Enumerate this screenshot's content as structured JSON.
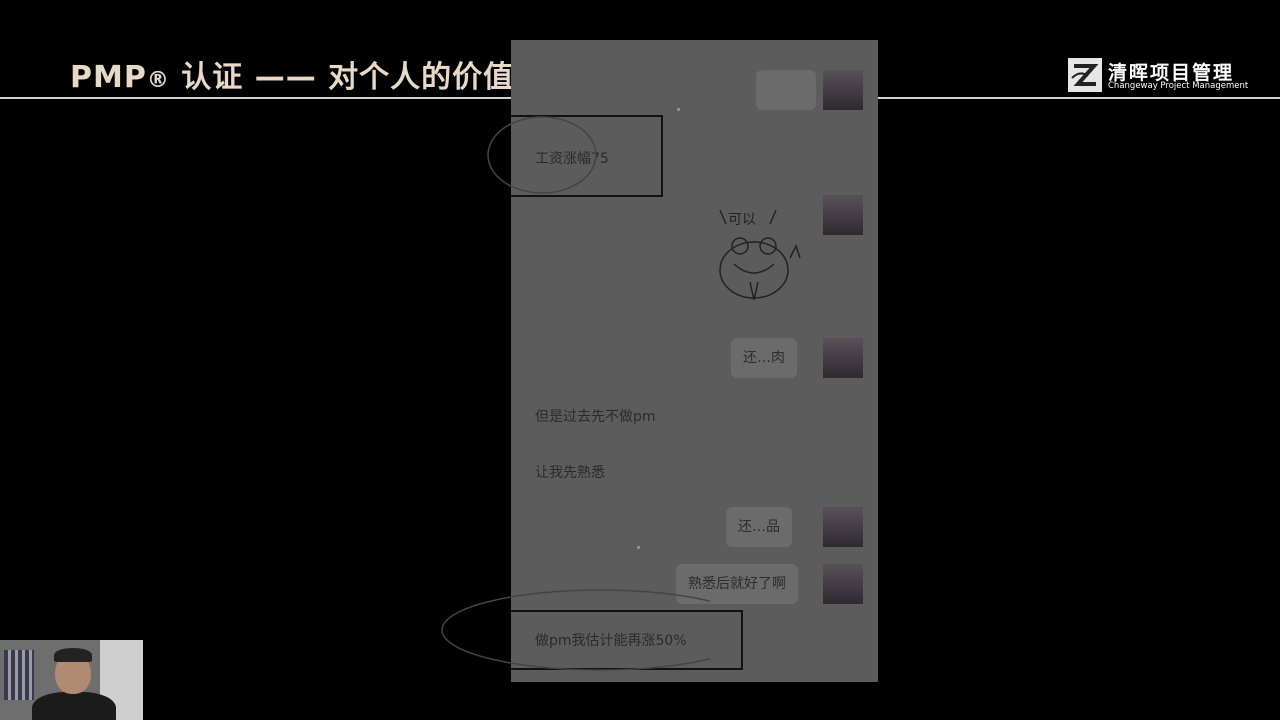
{
  "header": {
    "title_main": "PMP",
    "title_reg": "®",
    "title_rest": " 认证 —— 对个人的价值"
  },
  "logo": {
    "cn": "清晖项目管理",
    "en": "Changeway Project Management"
  },
  "chat": {
    "msg_salary": "工资涨幅75",
    "sticker_caption": "可以",
    "reply_1": "还…肉",
    "msg_but": "但是过去先不做pm",
    "msg_let": "让我先熟悉",
    "reply_2": "还…品",
    "reply_3": "熟悉后就好了啊",
    "msg_estimate": "做pm我估计能再涨50%"
  }
}
